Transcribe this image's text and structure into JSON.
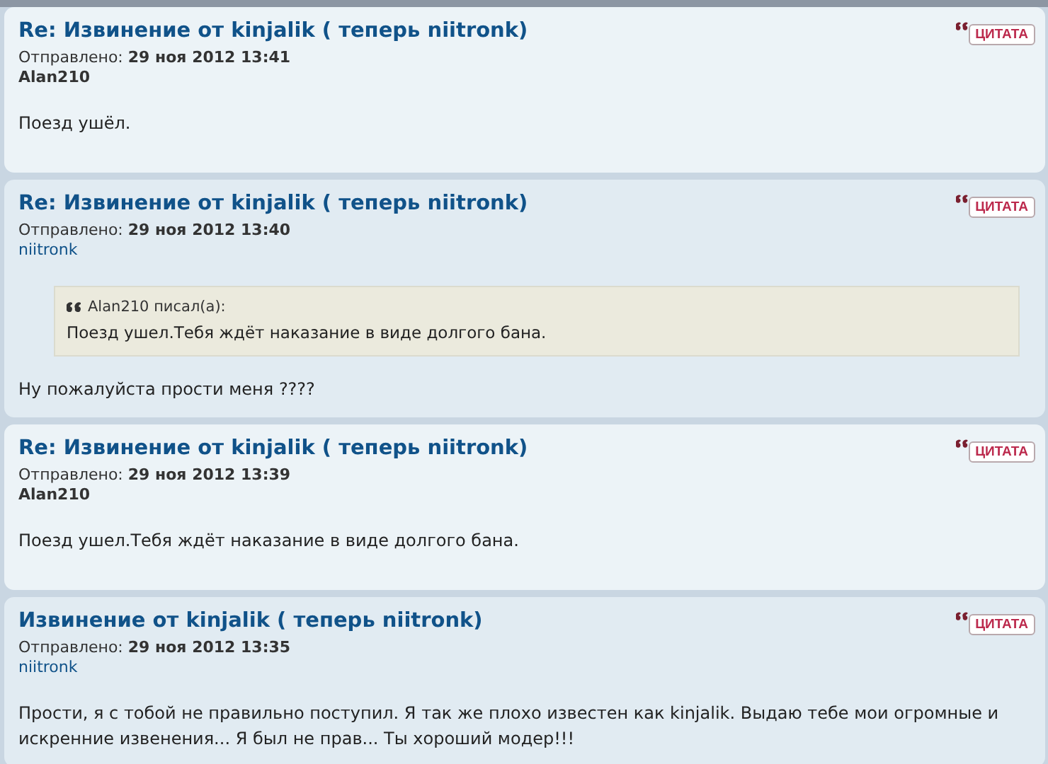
{
  "posts": [
    {
      "title": "Re: Извинение от kinjalik ( теперь niitronk)",
      "quote_button": "ЦИТАТА",
      "sent_label": "Отправлено:",
      "date": "29 ноя 2012 13:41",
      "author": "Alan210",
      "author_linked": false,
      "body": "Поезд ушёл."
    },
    {
      "title": "Re: Извинение от kinjalik ( теперь niitronk)",
      "quote_button": "ЦИТАТА",
      "sent_label": "Отправлено:",
      "date": "29 ноя 2012 13:40",
      "author": "niitronk",
      "author_linked": true,
      "quote": {
        "cite": "Alan210 писал(а):",
        "text": "Поезд ушел.Тебя ждёт наказание в виде долгого бана."
      },
      "body": "Ну пожалуйста прости меня ????"
    },
    {
      "title": "Re: Извинение от kinjalik ( теперь niitronk)",
      "quote_button": "ЦИТАТА",
      "sent_label": "Отправлено:",
      "date": "29 ноя 2012 13:39",
      "author": "Alan210",
      "author_linked": false,
      "body": "Поезд ушел.Тебя ждёт наказание в виде долгого бана."
    },
    {
      "title": "Извинение от kinjalik ( теперь niitronk)",
      "quote_button": "ЦИТАТА",
      "sent_label": "Отправлено:",
      "date": "29 ноя 2012 13:35",
      "author": "niitronk",
      "author_linked": true,
      "body": "Прости, я с тобой не правильно поступил. Я так же плохо известен как kinjalik. Выдаю тебе мои огромные и искренние извенения... Я был не прав... Ты хороший модер!!!"
    }
  ]
}
